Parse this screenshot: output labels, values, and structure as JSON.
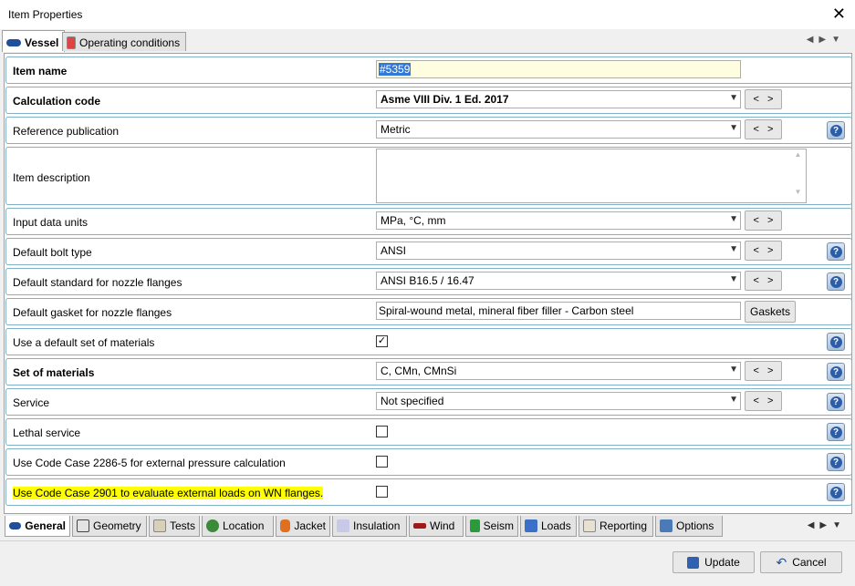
{
  "window": {
    "title": "Item Properties"
  },
  "top_tabs": [
    {
      "label": "Vessel"
    },
    {
      "label": "Operating conditions"
    }
  ],
  "rows": {
    "item_name": {
      "label": "Item name",
      "value": "#5359"
    },
    "calc_code": {
      "label": "Calculation code",
      "value": "Asme VIII Div. 1 Ed. 2017"
    },
    "ref_pub": {
      "label": "Reference publication",
      "value": "Metric"
    },
    "item_desc": {
      "label": "Item description",
      "value": ""
    },
    "units": {
      "label": "Input data units",
      "value": "MPa, °C, mm"
    },
    "bolt": {
      "label": "Default bolt type",
      "value": "ANSI"
    },
    "nozzle_std": {
      "label": "Default standard for nozzle flanges",
      "value": "ANSI B16.5 / 16.47"
    },
    "gasket": {
      "label": "Default gasket for nozzle flanges",
      "value": "Spiral-wound metal, mineral fiber filler - Carbon steel",
      "button": "Gaskets"
    },
    "default_set": {
      "label": "Use a default set of materials",
      "checked": true
    },
    "materials": {
      "label": "Set of materials",
      "value": "C, CMn, CMnSi"
    },
    "service": {
      "label": "Service",
      "value": "Not specified"
    },
    "lethal": {
      "label": "Lethal service",
      "checked": false
    },
    "cc2286": {
      "label": "Use Code Case 2286-5 for external pressure calculation",
      "checked": false
    },
    "cc2901": {
      "label": "Use Code Case 2901 to evaluate external loads on WN flanges.",
      "checked": false
    }
  },
  "nav": {
    "prev": "<",
    "next": ">"
  },
  "help_glyph": "?",
  "bottom_tabs": [
    "General",
    "Geometry",
    "Tests",
    "Location",
    "Jacket",
    "Insulation",
    "Wind",
    "Seism",
    "Loads",
    "Reporting",
    "Options"
  ],
  "footer": {
    "update": "Update",
    "cancel": "Cancel"
  },
  "colors": {
    "highlight": "#ffff00",
    "row_border": "#7fb0c8",
    "selection": "#3378d6"
  }
}
